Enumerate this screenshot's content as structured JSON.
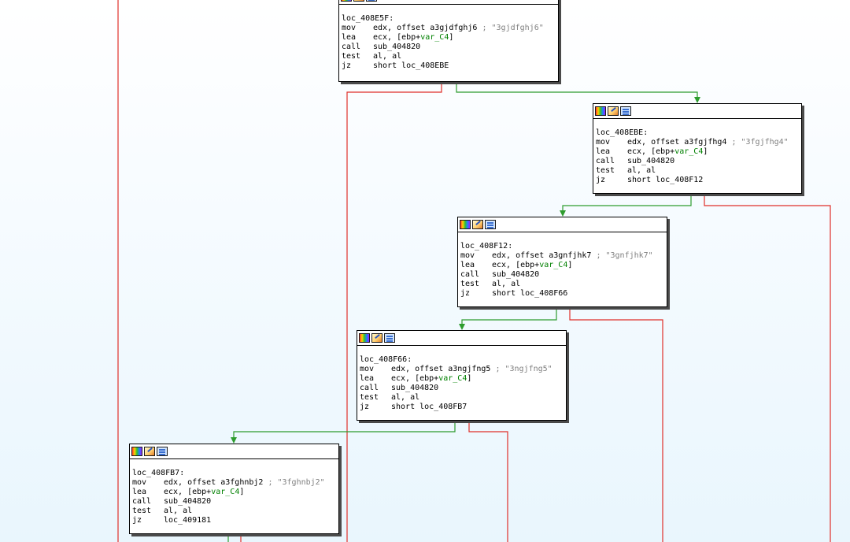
{
  "colors": {
    "edge_true": "#2e9c2e",
    "edge_false": "#e0302a",
    "background_top": "#ffffff",
    "background_bottom": "#e9f6fd",
    "local_var": "#008000",
    "comment": "#808080"
  },
  "header_icons": [
    "color-palette-icon",
    "rename-pencil-icon",
    "group-nodes-icon"
  ],
  "nodes": [
    {
      "id": "loc_408E5F",
      "label": "loc_408E5F:",
      "lines": [
        {
          "mnem": "mov",
          "ops": "edx, offset a3gjdfghj6",
          "comment": "; \"3gjdfghj6\""
        },
        {
          "mnem": "lea",
          "ops_pre": "ecx, [ebp+",
          "var": "var_C4",
          "ops_post": "]"
        },
        {
          "mnem": "call",
          "ops": "sub_404820"
        },
        {
          "mnem": "test",
          "ops": "al, al"
        },
        {
          "mnem": "jz",
          "ops": "short loc_408EBE"
        }
      ]
    },
    {
      "id": "loc_408EBE",
      "label": "loc_408EBE:",
      "lines": [
        {
          "mnem": "mov",
          "ops": "edx, offset a3fgjfhg4",
          "comment": "; \"3fgjfhg4\""
        },
        {
          "mnem": "lea",
          "ops_pre": "ecx, [ebp+",
          "var": "var_C4",
          "ops_post": "]"
        },
        {
          "mnem": "call",
          "ops": "sub_404820"
        },
        {
          "mnem": "test",
          "ops": "al, al"
        },
        {
          "mnem": "jz",
          "ops": "short loc_408F12"
        }
      ]
    },
    {
      "id": "loc_408F12",
      "label": "loc_408F12:",
      "lines": [
        {
          "mnem": "mov",
          "ops": "edx, offset a3gnfjhk7",
          "comment": "; \"3gnfjhk7\""
        },
        {
          "mnem": "lea",
          "ops_pre": "ecx, [ebp+",
          "var": "var_C4",
          "ops_post": "]"
        },
        {
          "mnem": "call",
          "ops": "sub_404820"
        },
        {
          "mnem": "test",
          "ops": "al, al"
        },
        {
          "mnem": "jz",
          "ops": "short loc_408F66"
        }
      ]
    },
    {
      "id": "loc_408F66",
      "label": "loc_408F66:",
      "lines": [
        {
          "mnem": "mov",
          "ops": "edx, offset a3ngjfng5",
          "comment": "; \"3ngjfng5\""
        },
        {
          "mnem": "lea",
          "ops_pre": "ecx, [ebp+",
          "var": "var_C4",
          "ops_post": "]"
        },
        {
          "mnem": "call",
          "ops": "sub_404820"
        },
        {
          "mnem": "test",
          "ops": "al, al"
        },
        {
          "mnem": "jz",
          "ops": "short loc_408FB7"
        }
      ]
    },
    {
      "id": "loc_408FB7",
      "label": "loc_408FB7:",
      "lines": [
        {
          "mnem": "mov",
          "ops": "edx, offset a3fghnbj2",
          "comment": "; \"3fghnbj2\""
        },
        {
          "mnem": "lea",
          "ops_pre": "ecx, [ebp+",
          "var": "var_C4",
          "ops_post": "]"
        },
        {
          "mnem": "call",
          "ops": "sub_404820"
        },
        {
          "mnem": "test",
          "ops": "al, al"
        },
        {
          "mnem": "jz",
          "ops": "loc_409181"
        }
      ]
    }
  ],
  "edges": [
    {
      "from": "loc_408E5F",
      "to": "loc_408EBE",
      "kind": "true"
    },
    {
      "from": "loc_408EBE",
      "to": "loc_408F12",
      "kind": "true"
    },
    {
      "from": "loc_408F12",
      "to": "loc_408F66",
      "kind": "true"
    },
    {
      "from": "loc_408F66",
      "to": "loc_408FB7",
      "kind": "true"
    }
  ]
}
